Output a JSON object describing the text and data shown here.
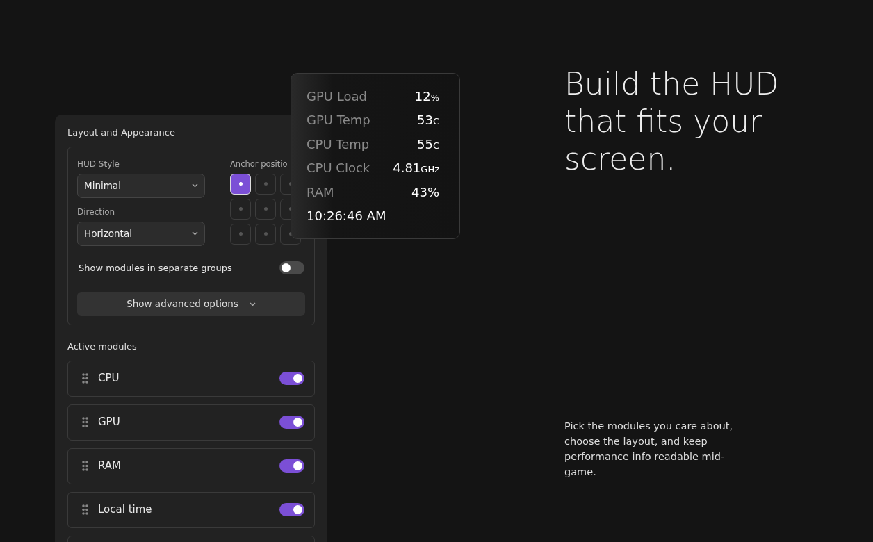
{
  "panel": {
    "title": "Layout and Appearance",
    "hud_style": {
      "label": "HUD Style",
      "value": "Minimal"
    },
    "direction": {
      "label": "Direction",
      "value": "Horizontal"
    },
    "anchor": {
      "label": "Anchor positio",
      "cells": [
        {
          "selected": true
        },
        {
          "selected": false
        },
        {
          "selected": false
        },
        {
          "selected": false
        },
        {
          "selected": false
        },
        {
          "selected": false
        },
        {
          "selected": false
        },
        {
          "selected": false
        },
        {
          "selected": false
        }
      ]
    },
    "separate_groups": {
      "label": "Show modules in separate groups",
      "on": false
    },
    "advanced_button": "Show advanced options",
    "modules_title": "Active modules",
    "modules": [
      {
        "label": "CPU",
        "on": true
      },
      {
        "label": "GPU",
        "on": true
      },
      {
        "label": "RAM",
        "on": true
      },
      {
        "label": "Local time",
        "on": true
      }
    ]
  },
  "hud": {
    "rows": [
      {
        "label": "GPU Load",
        "value": "12",
        "unit": "%"
      },
      {
        "label": "GPU Temp",
        "value": "53",
        "unit": "C"
      },
      {
        "label": "CPU Temp",
        "value": "55",
        "unit": "C"
      },
      {
        "label": "CPU Clock",
        "value": "4.81",
        "unit": "GHz"
      },
      {
        "label": "RAM",
        "value": "43%"
      }
    ],
    "time": "10:26:46 AM"
  },
  "headline": "Build the HUD that fits your screen.",
  "description": "Pick the modules you care about, choose the layout, and keep performance info readable mid-game."
}
